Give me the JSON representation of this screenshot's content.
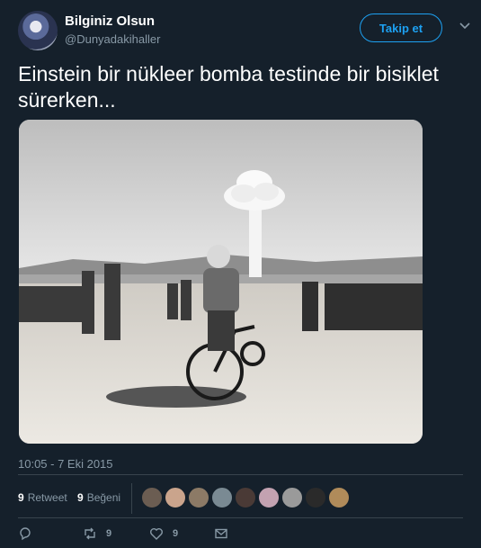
{
  "user": {
    "name": "Bilginiz Olsun",
    "handle": "@Dunyadakihaller"
  },
  "follow_label": "Takip et",
  "tweet": {
    "text": "Einstein bir nükleer bomba testinde bir bisiklet sürerken..."
  },
  "timestamp": "10:05 - 7 Eki 2015",
  "stats": {
    "retweets_count": "9",
    "retweets_label": "Retweet",
    "likes_count": "9",
    "likes_label": "Beğeni"
  },
  "actions": {
    "retweet_count": "9",
    "like_count": "9"
  },
  "icons": [
    "chevron-down-icon",
    "reply-icon",
    "retweet-icon",
    "heart-icon",
    "message-icon"
  ],
  "colors": {
    "background": "#15202b",
    "accent": "#1da1f2",
    "secondary_text": "#8899a6",
    "divider": "#38444d"
  }
}
